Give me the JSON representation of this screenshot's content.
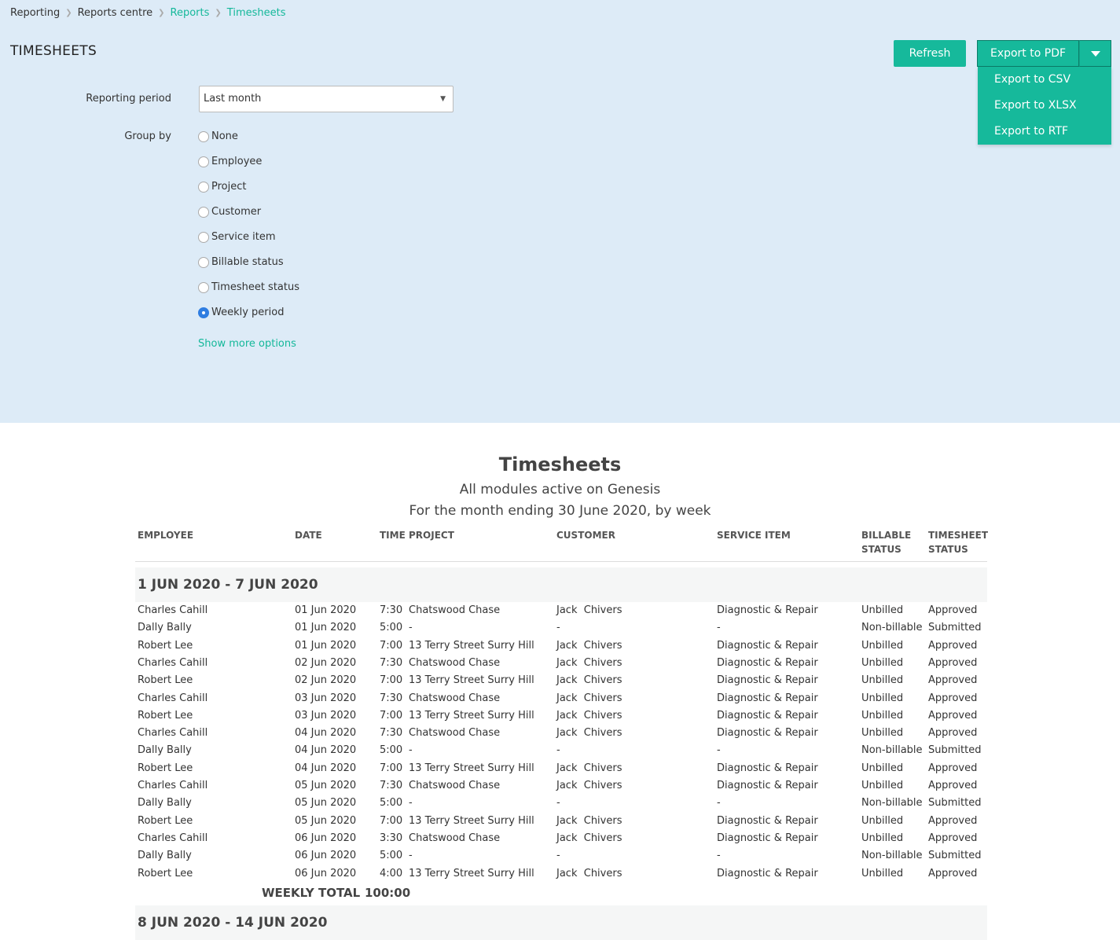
{
  "breadcrumb": [
    "Reporting",
    "Reports centre",
    "Reports",
    "Timesheets"
  ],
  "page_title": "TIMESHEETS",
  "buttons": {
    "refresh": "Refresh",
    "export_pdf": "Export to PDF"
  },
  "export_menu": [
    "Export to CSV",
    "Export to XLSX",
    "Export to RTF"
  ],
  "form": {
    "reporting_period_label": "Reporting period",
    "reporting_period_value": "Last month",
    "group_by_label": "Group by",
    "group_by_options": [
      "None",
      "Employee",
      "Project",
      "Customer",
      "Service item",
      "Billable status",
      "Timesheet status",
      "Weekly period"
    ],
    "group_by_selected": "Weekly period",
    "show_more": "Show more options"
  },
  "report": {
    "title": "Timesheets",
    "subtitle1": "All modules active on Genesis",
    "subtitle2": "For the month ending 30 June 2020, by week",
    "columns": [
      "EMPLOYEE",
      "DATE",
      "TIME",
      "PROJECT",
      "CUSTOMER",
      "SERVICE ITEM",
      "BILLABLE\nSTATUS",
      "TIMESHEET\nSTATUS"
    ],
    "groups": [
      {
        "title": "1 JUN 2020 - 7 JUN 2020",
        "rows": [
          [
            "Charles Cahill",
            "01 Jun 2020",
            "7:30",
            "Chatswood Chase",
            "Jack  Chivers",
            "Diagnostic & Repair",
            "Unbilled",
            "Approved"
          ],
          [
            "Dally Bally",
            "01 Jun 2020",
            "5:00",
            "-",
            "-",
            "-",
            "Non-billable",
            "Submitted"
          ],
          [
            "Robert Lee",
            "01 Jun 2020",
            "7:00",
            "13 Terry Street Surry Hill",
            "Jack  Chivers",
            "Diagnostic & Repair",
            "Unbilled",
            "Approved"
          ],
          [
            "Charles Cahill",
            "02 Jun 2020",
            "7:30",
            "Chatswood Chase",
            "Jack  Chivers",
            "Diagnostic & Repair",
            "Unbilled",
            "Approved"
          ],
          [
            "Robert Lee",
            "02 Jun 2020",
            "7:00",
            "13 Terry Street Surry Hill",
            "Jack  Chivers",
            "Diagnostic & Repair",
            "Unbilled",
            "Approved"
          ],
          [
            "Charles Cahill",
            "03 Jun 2020",
            "7:30",
            "Chatswood Chase",
            "Jack  Chivers",
            "Diagnostic & Repair",
            "Unbilled",
            "Approved"
          ],
          [
            "Robert Lee",
            "03 Jun 2020",
            "7:00",
            "13 Terry Street Surry Hill",
            "Jack  Chivers",
            "Diagnostic & Repair",
            "Unbilled",
            "Approved"
          ],
          [
            "Charles Cahill",
            "04 Jun 2020",
            "7:30",
            "Chatswood Chase",
            "Jack  Chivers",
            "Diagnostic & Repair",
            "Unbilled",
            "Approved"
          ],
          [
            "Dally Bally",
            "04 Jun 2020",
            "5:00",
            "-",
            "-",
            "-",
            "Non-billable",
            "Submitted"
          ],
          [
            "Robert Lee",
            "04 Jun 2020",
            "7:00",
            "13 Terry Street Surry Hill",
            "Jack  Chivers",
            "Diagnostic & Repair",
            "Unbilled",
            "Approved"
          ],
          [
            "Charles Cahill",
            "05 Jun 2020",
            "7:30",
            "Chatswood Chase",
            "Jack  Chivers",
            "Diagnostic & Repair",
            "Unbilled",
            "Approved"
          ],
          [
            "Dally Bally",
            "05 Jun 2020",
            "5:00",
            "-",
            "-",
            "-",
            "Non-billable",
            "Submitted"
          ],
          [
            "Robert Lee",
            "05 Jun 2020",
            "7:00",
            "13 Terry Street Surry Hill",
            "Jack  Chivers",
            "Diagnostic & Repair",
            "Unbilled",
            "Approved"
          ],
          [
            "Charles Cahill",
            "06 Jun 2020",
            "3:30",
            "Chatswood Chase",
            "Jack  Chivers",
            "Diagnostic & Repair",
            "Unbilled",
            "Approved"
          ],
          [
            "Dally Bally",
            "06 Jun 2020",
            "5:00",
            "-",
            "-",
            "-",
            "Non-billable",
            "Submitted"
          ],
          [
            "Robert Lee",
            "06 Jun 2020",
            "4:00",
            "13 Terry Street Surry Hill",
            "Jack  Chivers",
            "Diagnostic & Repair",
            "Unbilled",
            "Approved"
          ]
        ],
        "total_label": "WEEKLY TOTAL",
        "total_value": "100:00"
      },
      {
        "title": "8 JUN 2020 - 14 JUN 2020",
        "rows": []
      }
    ]
  },
  "colors": {
    "accent": "#16b99b",
    "panel_bg": "#ddebf7",
    "radio_selected": "#2f7de1"
  }
}
